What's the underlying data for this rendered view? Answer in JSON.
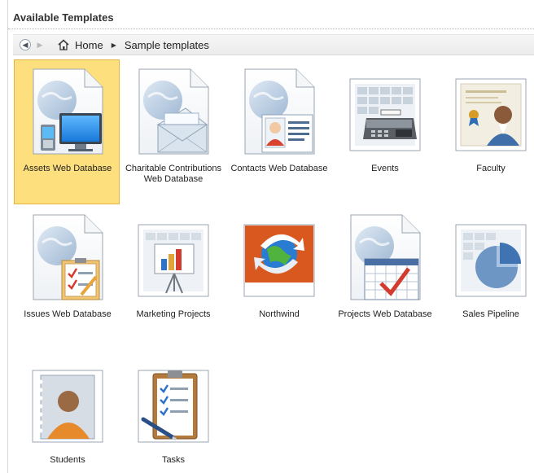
{
  "panel": {
    "title": "Available Templates"
  },
  "nav": {
    "crumbs": [
      "Home",
      "Sample templates"
    ]
  },
  "templates": [
    {
      "label": "Assets Web Database",
      "selected": true,
      "icon": "assets-web-database-icon"
    },
    {
      "label": "Charitable Contributions Web Database",
      "selected": false,
      "icon": "charitable-contributions-icon"
    },
    {
      "label": "Contacts Web Database",
      "selected": false,
      "icon": "contacts-web-database-icon"
    },
    {
      "label": "Events",
      "selected": false,
      "icon": "events-icon"
    },
    {
      "label": "Faculty",
      "selected": false,
      "icon": "faculty-icon"
    },
    {
      "label": "Issues Web Database",
      "selected": false,
      "icon": "issues-web-database-icon"
    },
    {
      "label": "Marketing Projects",
      "selected": false,
      "icon": "marketing-projects-icon"
    },
    {
      "label": "Northwind",
      "selected": false,
      "icon": "northwind-icon"
    },
    {
      "label": "Projects Web Database",
      "selected": false,
      "icon": "projects-web-database-icon"
    },
    {
      "label": "Sales Pipeline",
      "selected": false,
      "icon": "sales-pipeline-icon"
    },
    {
      "label": "Students",
      "selected": false,
      "icon": "students-icon"
    },
    {
      "label": "Tasks",
      "selected": false,
      "icon": "tasks-icon"
    }
  ],
  "colors": {
    "selection": "#fddf7d",
    "selection_border": "#e2b440"
  }
}
